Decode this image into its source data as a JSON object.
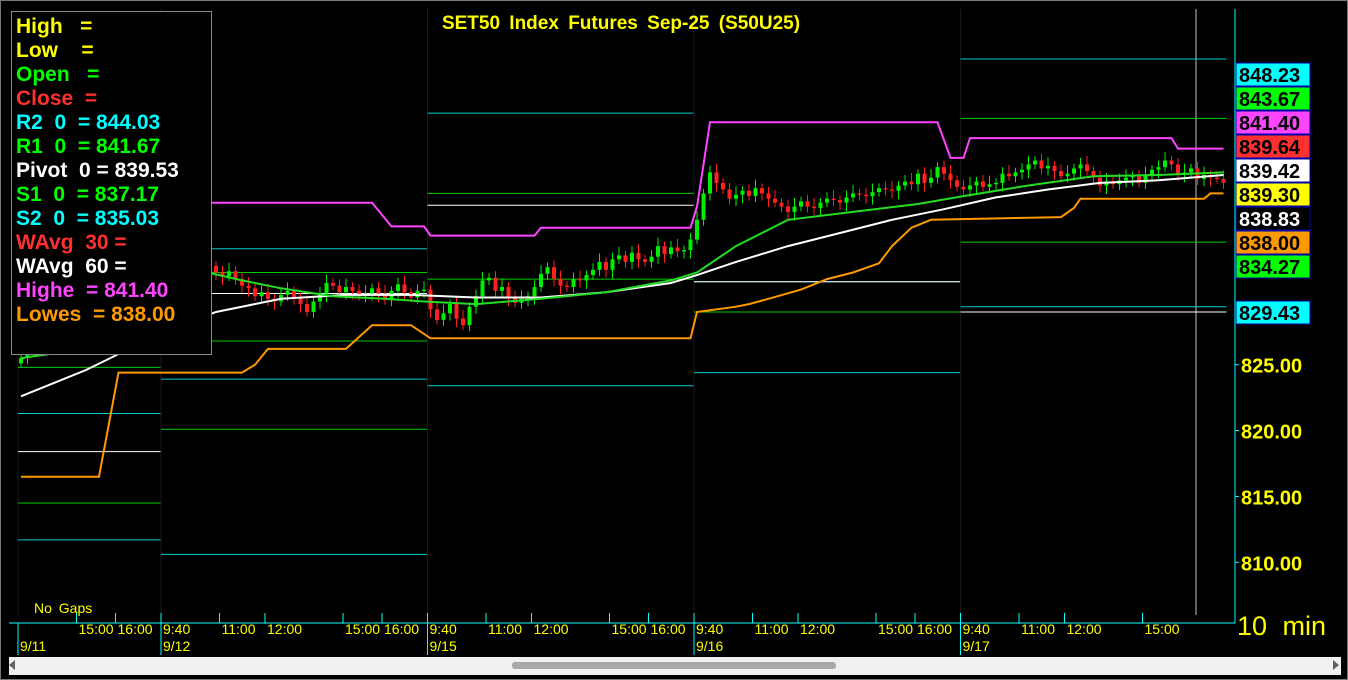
{
  "title": "SET50 Index Futures Sep-25 (S50U25)",
  "timeframe": "10 min",
  "gaps_label": "No Gaps",
  "legend": [
    {
      "text": "High   =",
      "color": "#ffff00"
    },
    {
      "text": "Low    =",
      "color": "#ffff00"
    },
    {
      "text": "Open   =",
      "color": "#00ff00"
    },
    {
      "text": "Close  =",
      "color": "#ff3030"
    },
    {
      "text": "R2  0  = 844.03",
      "color": "#00ffff"
    },
    {
      "text": "R1  0  = 841.67",
      "color": "#00ff00"
    },
    {
      "text": "Pivot  0 = 839.53",
      "color": "#ffffff"
    },
    {
      "text": "S1  0  = 837.17",
      "color": "#00ff00"
    },
    {
      "text": "S2  0  = 835.03",
      "color": "#00ffff"
    },
    {
      "text": "WAvg  30 =",
      "color": "#ff3030"
    },
    {
      "text": "WAvg  60 =",
      "color": "#ffffff"
    },
    {
      "text": "Highe  = 841.40",
      "color": "#ff44ff"
    },
    {
      "text": "Lowes  = 838.00",
      "color": "#ff9900"
    }
  ],
  "price_labels": [
    {
      "value": 848.23,
      "text": "848.23",
      "bg": "#00ffff",
      "fg": "#000000"
    },
    {
      "value": 843.67,
      "text": "843.67",
      "bg": "#00ff00",
      "fg": "#000000"
    },
    {
      "value": 841.4,
      "text": "841.40",
      "bg": "#ff44ff",
      "fg": "#000000"
    },
    {
      "value": 839.64,
      "text": "839.64",
      "bg": "#ff3030",
      "fg": "#000000"
    },
    {
      "value": 839.42,
      "text": "839.42",
      "bg": "#ffffff",
      "fg": "#000000"
    },
    {
      "value": 839.3,
      "text": "839.30",
      "bg": "#ffff00",
      "fg": "#000000"
    },
    {
      "value": 838.83,
      "text": "838.83",
      "bg": "#000000",
      "fg": "#ffffff"
    },
    {
      "value": 838.0,
      "text": "838.00",
      "bg": "#ff9900",
      "fg": "#000000"
    },
    {
      "value": 834.27,
      "text": "834.27",
      "bg": "#00ff00",
      "fg": "#000000"
    },
    {
      "value": 829.43,
      "text": "829.43",
      "bg": "#00ffff",
      "fg": "#000000"
    }
  ],
  "chart_data": {
    "type": "candlestick",
    "title": "SET50 Index Futures Sep-25 (S50U25)",
    "ylim": [
      806.0,
      852.0
    ],
    "yticks": [
      {
        "value": 825,
        "label": "825.00"
      },
      {
        "value": 820,
        "label": "820.00"
      },
      {
        "value": 815,
        "label": "815.00"
      },
      {
        "value": 810,
        "label": "810.00"
      }
    ],
    "sessions": [
      {
        "date": "9/11",
        "start": 0,
        "end": 21
      },
      {
        "date": "9/12",
        "start": 22,
        "end": 62
      },
      {
        "date": "9/15",
        "start": 63,
        "end": 103
      },
      {
        "date": "9/16",
        "start": 104,
        "end": 144
      },
      {
        "date": "9/17",
        "start": 145,
        "end": 185
      }
    ],
    "time_labels": [
      {
        "x": 9,
        "label": "15:00"
      },
      {
        "x": 15,
        "label": "16:00"
      },
      {
        "x": 22,
        "label": "9:40"
      },
      {
        "x": 31,
        "label": "11:00"
      },
      {
        "x": 38,
        "label": "12:00"
      },
      {
        "x": 50,
        "label": "15:00"
      },
      {
        "x": 56,
        "label": "16:00"
      },
      {
        "x": 63,
        "label": "9:40"
      },
      {
        "x": 72,
        "label": "11:00"
      },
      {
        "x": 79,
        "label": "12:00"
      },
      {
        "x": 91,
        "label": "15:00"
      },
      {
        "x": 97,
        "label": "16:00"
      },
      {
        "x": 104,
        "label": "9:40"
      },
      {
        "x": 113,
        "label": "11:00"
      },
      {
        "x": 120,
        "label": "12:00"
      },
      {
        "x": 132,
        "label": "15:00"
      },
      {
        "x": 138,
        "label": "16:00"
      },
      {
        "x": 145,
        "label": "9:40"
      },
      {
        "x": 154,
        "label": "11:00"
      },
      {
        "x": 161,
        "label": "12:00"
      },
      {
        "x": 173,
        "label": "15:00"
      }
    ],
    "date_labels": [
      {
        "x": 0,
        "label": "9/11"
      },
      {
        "x": 22,
        "label": "9/12"
      },
      {
        "x": 63,
        "label": "9/15"
      },
      {
        "x": 104,
        "label": "9/16"
      },
      {
        "x": 145,
        "label": "9/17"
      }
    ],
    "pivots": [
      {
        "start": 0,
        "end": 21,
        "R2": 841.5,
        "R1": 838.5,
        "P": 836.0,
        "S1": 832.5,
        "S2": 829.5,
        "R0": 0,
        "S3": 824.8,
        "S4": 821.3,
        "P2": 818.4,
        "S5": 814.5,
        "S6": 811.7
      },
      {
        "start": 22,
        "end": 62,
        "R2": 833.8,
        "R1": 832.0,
        "P": 830.4,
        "S1": 826.8,
        "S2": 823.9,
        "S3": 820.1,
        "S4": 810.6
      },
      {
        "start": 63,
        "end": 103,
        "R2": 844.1,
        "R1": 838.0,
        "P": 837.1,
        "S1": 831.5,
        "S2": 823.4
      },
      {
        "start": 104,
        "end": 144,
        "R2": 831.3,
        "P": 831.3,
        "S1": 829.0,
        "S2": 824.4
      },
      {
        "start": 145,
        "end": 185,
        "R2": 848.2,
        "R1": 843.7,
        "P": 829.0,
        "S1": 834.3,
        "S2": 829.4
      }
    ],
    "highest": [
      [
        0,
        832.6
      ],
      [
        21,
        832.6
      ],
      [
        22,
        837.3
      ],
      [
        54,
        837.3
      ],
      [
        57,
        835.5
      ],
      [
        62,
        835.5
      ],
      [
        63,
        834.8
      ],
      [
        79,
        834.8
      ],
      [
        80,
        835.4
      ],
      [
        103,
        835.4
      ],
      [
        104,
        837.0
      ],
      [
        106,
        843.4
      ],
      [
        141,
        843.4
      ],
      [
        143,
        840.7
      ],
      [
        145,
        840.7
      ],
      [
        146,
        842.2
      ],
      [
        177,
        842.2
      ],
      [
        178,
        841.4
      ],
      [
        185,
        841.4
      ]
    ],
    "lowest": [
      [
        0,
        816.5
      ],
      [
        12,
        816.5
      ],
      [
        15,
        824.4
      ],
      [
        34,
        824.4
      ],
      [
        36,
        825.0
      ],
      [
        38,
        826.2
      ],
      [
        50,
        826.2
      ],
      [
        54,
        828.0
      ],
      [
        60,
        828.0
      ],
      [
        63,
        827.0
      ],
      [
        103,
        827.0
      ],
      [
        104,
        829.0
      ],
      [
        110,
        829.4
      ],
      [
        112,
        829.6
      ],
      [
        115,
        830.0
      ],
      [
        120,
        830.7
      ],
      [
        124,
        831.5
      ],
      [
        128,
        832.0
      ],
      [
        132,
        832.7
      ],
      [
        134,
        834.0
      ],
      [
        137,
        835.4
      ],
      [
        140,
        836.0
      ],
      [
        160,
        836.2
      ],
      [
        162,
        836.9
      ],
      [
        163,
        837.6
      ],
      [
        182,
        837.6
      ],
      [
        183,
        838.0
      ],
      [
        185,
        838.0
      ]
    ],
    "wavg30": [
      [
        0,
        825.5
      ],
      [
        14,
        826.5
      ],
      [
        22,
        832.0
      ],
      [
        26,
        832.3
      ],
      [
        34,
        831.4
      ],
      [
        40,
        830.8
      ],
      [
        48,
        830.2
      ],
      [
        56,
        830.0
      ],
      [
        62,
        829.8
      ],
      [
        70,
        829.6
      ],
      [
        80,
        830.0
      ],
      [
        90,
        830.5
      ],
      [
        100,
        831.4
      ],
      [
        104,
        832.0
      ],
      [
        110,
        834.0
      ],
      [
        118,
        836.0
      ],
      [
        128,
        836.6
      ],
      [
        138,
        837.2
      ],
      [
        145,
        837.8
      ],
      [
        155,
        838.6
      ],
      [
        165,
        839.3
      ],
      [
        175,
        839.4
      ],
      [
        185,
        839.6
      ]
    ],
    "wavg60": [
      [
        0,
        822.6
      ],
      [
        10,
        824.6
      ],
      [
        22,
        827.5
      ],
      [
        30,
        829.0
      ],
      [
        40,
        830.0
      ],
      [
        50,
        830.3
      ],
      [
        60,
        830.3
      ],
      [
        70,
        830.1
      ],
      [
        80,
        830.1
      ],
      [
        90,
        830.5
      ],
      [
        100,
        831.2
      ],
      [
        104,
        831.8
      ],
      [
        110,
        832.8
      ],
      [
        118,
        834.0
      ],
      [
        126,
        835.0
      ],
      [
        134,
        836.0
      ],
      [
        142,
        836.8
      ],
      [
        150,
        837.7
      ],
      [
        158,
        838.3
      ],
      [
        166,
        838.8
      ],
      [
        175,
        839.0
      ],
      [
        185,
        839.4
      ]
    ],
    "closes": [
      825.5,
      826.2,
      826.6,
      827.4,
      826.7,
      828.0,
      828.6,
      828.9,
      828.1,
      829.4,
      829.9,
      830.5,
      831.0,
      831.9,
      831.6,
      832.4,
      832.2,
      833.0,
      833.2,
      832.3,
      831.9,
      832.5,
      833.1,
      832.7,
      833.3,
      832.8,
      832.3,
      832.9,
      832.4,
      832.5,
      832.0,
      831.7,
      832.1,
      831.5,
      831.0,
      830.8,
      830.2,
      830.5,
      830.0,
      829.8,
      830.3,
      830.6,
      830.1,
      829.6,
      829.0,
      829.8,
      830.4,
      831.2,
      831.0,
      830.5,
      830.9,
      830.6,
      830.2,
      830.4,
      830.8,
      830.4,
      829.9,
      830.6,
      831.1,
      830.5,
      830.1,
      830.6,
      830.7,
      829.2,
      828.4,
      828.9,
      829.6,
      828.5,
      828.0,
      829.4,
      830.2,
      831.4,
      831.6,
      830.6,
      830.9,
      830.1,
      829.7,
      830.0,
      830.2,
      830.9,
      831.9,
      832.4,
      831.5,
      831.0,
      830.9,
      831.5,
      831.4,
      831.8,
      832.2,
      832.8,
      832.2,
      833.0,
      833.3,
      832.8,
      833.5,
      833.0,
      832.8,
      833.2,
      834.0,
      833.4,
      833.9,
      833.6,
      833.7,
      834.5,
      836.0,
      838.0,
      839.6,
      838.8,
      838.3,
      837.6,
      837.9,
      838.2,
      837.8,
      838.4,
      838.0,
      837.6,
      837.3,
      837.0,
      836.6,
      837.0,
      837.4,
      837.0,
      836.9,
      837.3,
      837.6,
      837.5,
      837.3,
      837.7,
      838.0,
      837.9,
      837.8,
      838.1,
      838.4,
      838.3,
      838.2,
      838.6,
      838.9,
      838.7,
      839.5,
      838.8,
      839.2,
      840.0,
      839.5,
      839.0,
      838.5,
      838.3,
      838.6,
      838.9,
      838.5,
      838.7,
      838.8,
      839.5,
      839.3,
      839.6,
      839.8,
      840.2,
      840.5,
      839.9,
      840.1,
      839.7,
      839.3,
      839.5,
      839.9,
      840.2,
      839.7,
      839.2,
      838.6,
      838.9,
      838.7,
      839.0,
      839.2,
      839.3,
      838.8,
      839.4,
      839.8,
      840.0,
      840.5,
      840.2,
      839.5,
      839.6,
      839.9,
      839.1,
      839.4,
      839.2,
      839.1,
      838.8
    ]
  }
}
